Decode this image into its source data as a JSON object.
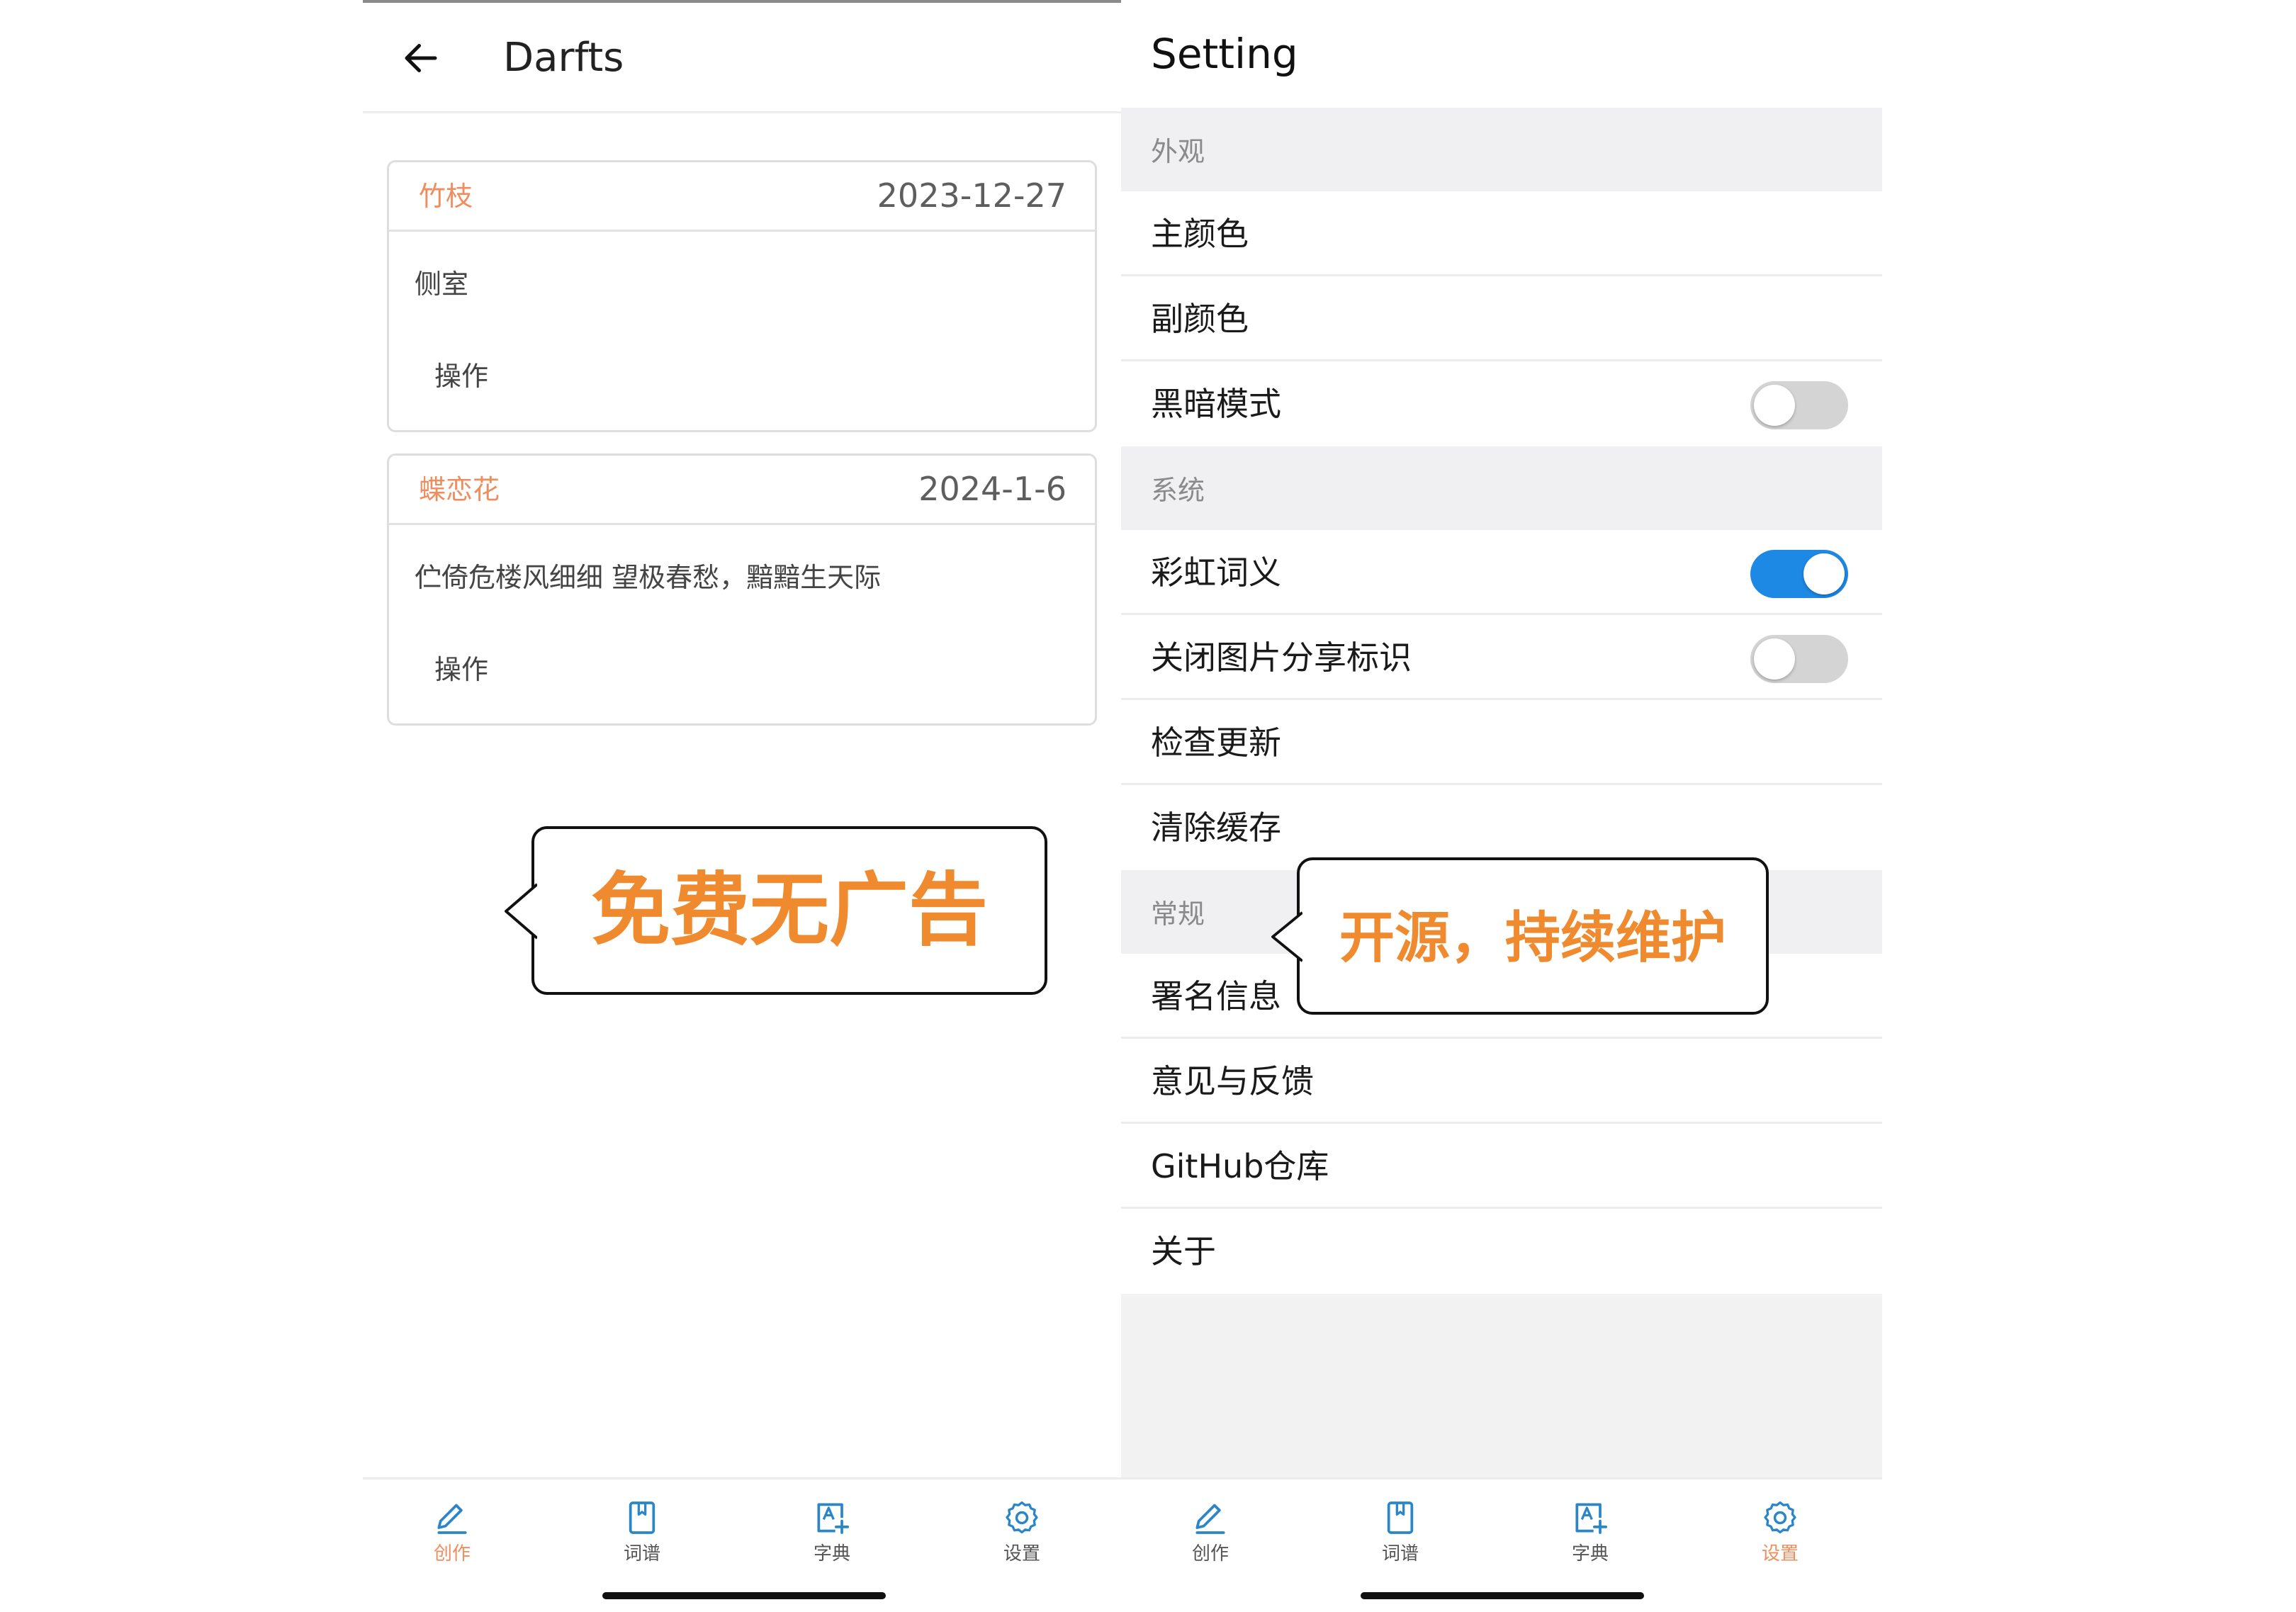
{
  "drafts": {
    "title": "Darfts",
    "cards": [
      {
        "title": "竹枝",
        "date": "2023-12-27",
        "content": "侧室",
        "action": "操作"
      },
      {
        "title": "蝶恋花",
        "date": "2024-1-6",
        "content": "伫倚危楼风细细 望极春愁，黯黯生天际",
        "action": "操作"
      }
    ]
  },
  "settings": {
    "title": "Setting",
    "sections": [
      {
        "label": "外观",
        "rows": [
          {
            "label": "主颜色"
          },
          {
            "label": "副颜色"
          },
          {
            "label": "黑暗模式",
            "toggle": false
          }
        ]
      },
      {
        "label": "系统",
        "rows": [
          {
            "label": "彩虹词义",
            "toggle": true
          },
          {
            "label": "关闭图片分享标识",
            "toggle": false
          },
          {
            "label": "检查更新"
          },
          {
            "label": "清除缓存"
          }
        ]
      },
      {
        "label": "常规",
        "rows": [
          {
            "label": "署名信息"
          },
          {
            "label": "意见与反馈"
          },
          {
            "label": "GitHub仓库"
          },
          {
            "label": "关于"
          }
        ]
      }
    ]
  },
  "tabs": [
    {
      "label": "创作",
      "icon": "pencil-icon"
    },
    {
      "label": "词谱",
      "icon": "book-icon"
    },
    {
      "label": "字典",
      "icon": "dictionary-icon"
    },
    {
      "label": "设置",
      "icon": "gear-icon"
    }
  ],
  "callouts": {
    "left": "免费无广告",
    "right": "开源，持续维护"
  },
  "colors": {
    "accent_orange": "#ee8e5e",
    "callout_orange": "#f08a2e",
    "toggle_on": "#1e88e5",
    "icon_blue": "#2a86c8"
  }
}
